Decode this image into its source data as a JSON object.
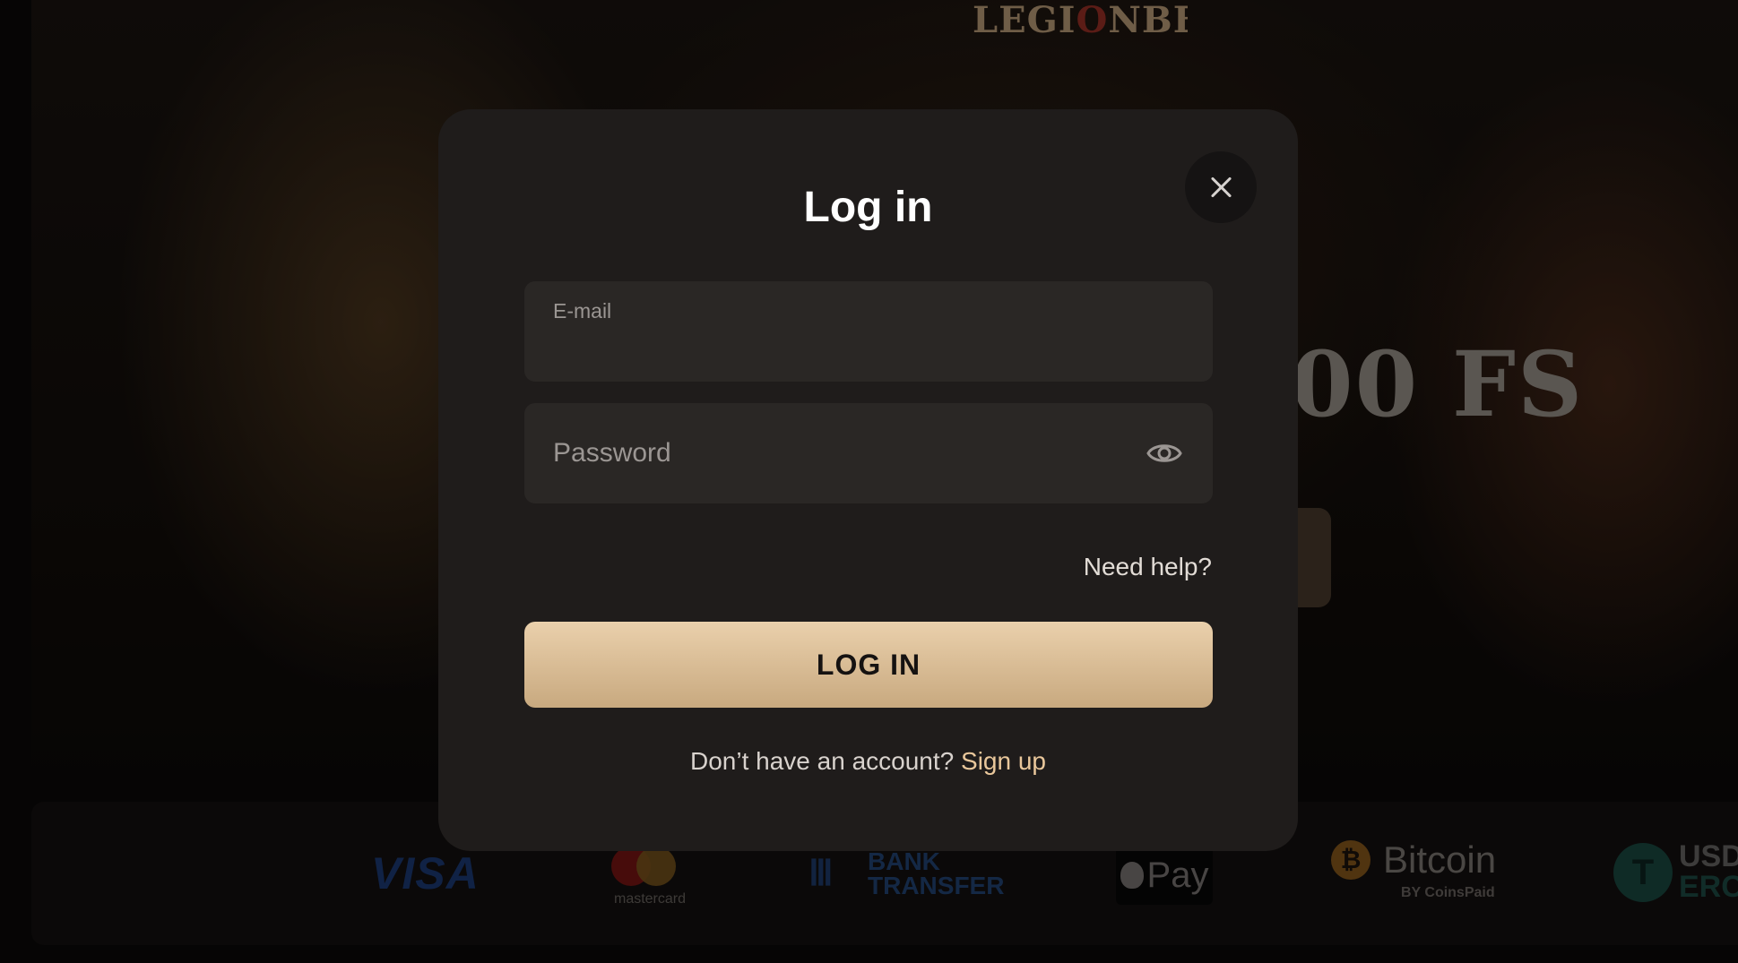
{
  "background": {
    "logo": {
      "main": "LEGI",
      "mark": "O",
      "rest": "NBET"
    },
    "bonus_text": "00 FS",
    "payments": {
      "visa": "VISA",
      "mastercard": "mastercard",
      "bank_transfer": "BANK\nTRANSFER",
      "apple_pay": "Pay",
      "bitcoin": "Bitcoin",
      "bitcoin_sub": "BY CoinsPaid",
      "usdt": "USD",
      "usdt_second": "ERC"
    }
  },
  "modal": {
    "title": "Log in",
    "email": {
      "label": "E-mail",
      "value": ""
    },
    "password": {
      "placeholder": "Password",
      "value": ""
    },
    "need_help": "Need help?",
    "login_button": "LOG IN",
    "signup_prompt": "Don’t have an account?",
    "signup_link": "Sign up"
  },
  "colors": {
    "modal_bg": "#1f1c1b",
    "field_bg": "#2a2725",
    "accent": "#e9c79b",
    "button_gradient_top": "#ead0ac",
    "button_gradient_bottom": "#c8a97f"
  }
}
